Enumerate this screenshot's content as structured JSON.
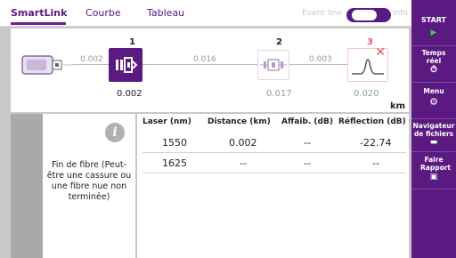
{
  "tabs": [
    {
      "label": "SmartLink",
      "active": true
    },
    {
      "label": "Courbe",
      "active": false
    },
    {
      "label": "Tableau",
      "active": false
    }
  ],
  "event_line": {
    "label": "Event line",
    "info_label": "Info",
    "enabled": true
  },
  "linkmap": {
    "events": [
      {
        "number": "1",
        "position": "0.002",
        "color": "#222222"
      },
      {
        "number": "2",
        "position": "0.017",
        "color": "#222222"
      },
      {
        "number": "3",
        "position": "0.020",
        "color": "#e05a6a"
      }
    ],
    "segments": [
      "0.002",
      "0.016",
      "0.003"
    ],
    "unit": "km"
  },
  "info": {
    "text": "Fin de fibre (Peut-être une cassure ou une fibre nue non terminée)"
  },
  "table": {
    "columns": [
      "Laser (nm)",
      "Distance (km)",
      "Affaib. (dB)",
      "Réflection (dB)"
    ],
    "rows": [
      [
        "1550",
        "0.002",
        "--",
        "-22.74"
      ],
      [
        "1625",
        "--",
        "--",
        "--"
      ]
    ]
  },
  "sidebar": {
    "start": "START",
    "realtime": "Temps réel",
    "menu": "Menu",
    "navigator": "Navigateur de fichiers",
    "report": "Faire Rapport"
  },
  "colors": {
    "brand": "#5a1a82",
    "fault": "#e05a6a"
  }
}
